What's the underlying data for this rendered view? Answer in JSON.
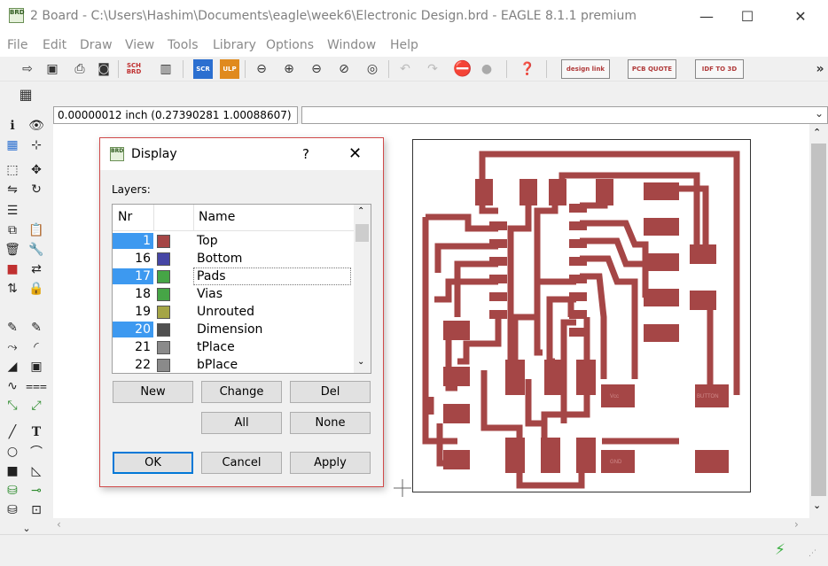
{
  "window": {
    "icon_label": "BRD",
    "title": "2 Board - C:\\Users\\Hashim\\Documents\\eagle\\week6\\Electronic Design.brd - EAGLE 8.1.1 premium",
    "controls": {
      "minimize": "—",
      "maximize": "☐",
      "close": "✕"
    }
  },
  "menu": [
    "File",
    "Edit",
    "Draw",
    "View",
    "Tools",
    "Library",
    "Options",
    "Window",
    "Help"
  ],
  "toolbar": {
    "sch_brd_label": "SCH BRD",
    "scr_label": "SCR",
    "ulp_label": "ULP",
    "designlink_label": "design link",
    "pcb_quote_label": "PCB QUOTE",
    "idf_label": "IDF TO 3D",
    "overflow": "»"
  },
  "coordinate_readout": "0.00000012 inch (0.27390281 1.00088607)",
  "dialog": {
    "icon_label": "BRD",
    "title": "Display",
    "help": "?",
    "close": "✕",
    "layers_label": "Layers:",
    "columns": {
      "nr": "Nr",
      "name": "Name"
    },
    "layers": [
      {
        "nr": "1",
        "name": "Top",
        "color": "#a54646",
        "selected": true
      },
      {
        "nr": "16",
        "name": "Bottom",
        "color": "#4646a5",
        "selected": false
      },
      {
        "nr": "17",
        "name": "Pads",
        "color": "#46a546",
        "selected": true
      },
      {
        "nr": "18",
        "name": "Vias",
        "color": "#46a546",
        "selected": false
      },
      {
        "nr": "19",
        "name": "Unrouted",
        "color": "#a5a546",
        "selected": false
      },
      {
        "nr": "20",
        "name": "Dimension",
        "color": "#505050",
        "selected": true
      },
      {
        "nr": "21",
        "name": "tPlace",
        "color": "#8a8a8a",
        "selected": false
      },
      {
        "nr": "22",
        "name": "bPlace",
        "color": "#8a8a8a",
        "selected": false
      }
    ],
    "buttons": {
      "new": "New",
      "change": "Change",
      "del": "Del",
      "all": "All",
      "none": "None",
      "ok": "OK",
      "cancel": "Cancel",
      "apply": "Apply"
    }
  },
  "pcb": {
    "copper_color": "#a54646",
    "pad_labels": {
      "vcc": "Vcc",
      "button": "BUTTON",
      "gnd": "GND"
    }
  },
  "colors": {
    "selection": "#3d99f0",
    "dialog_border": "#d04a4a",
    "go_icon": "#3cb043"
  }
}
